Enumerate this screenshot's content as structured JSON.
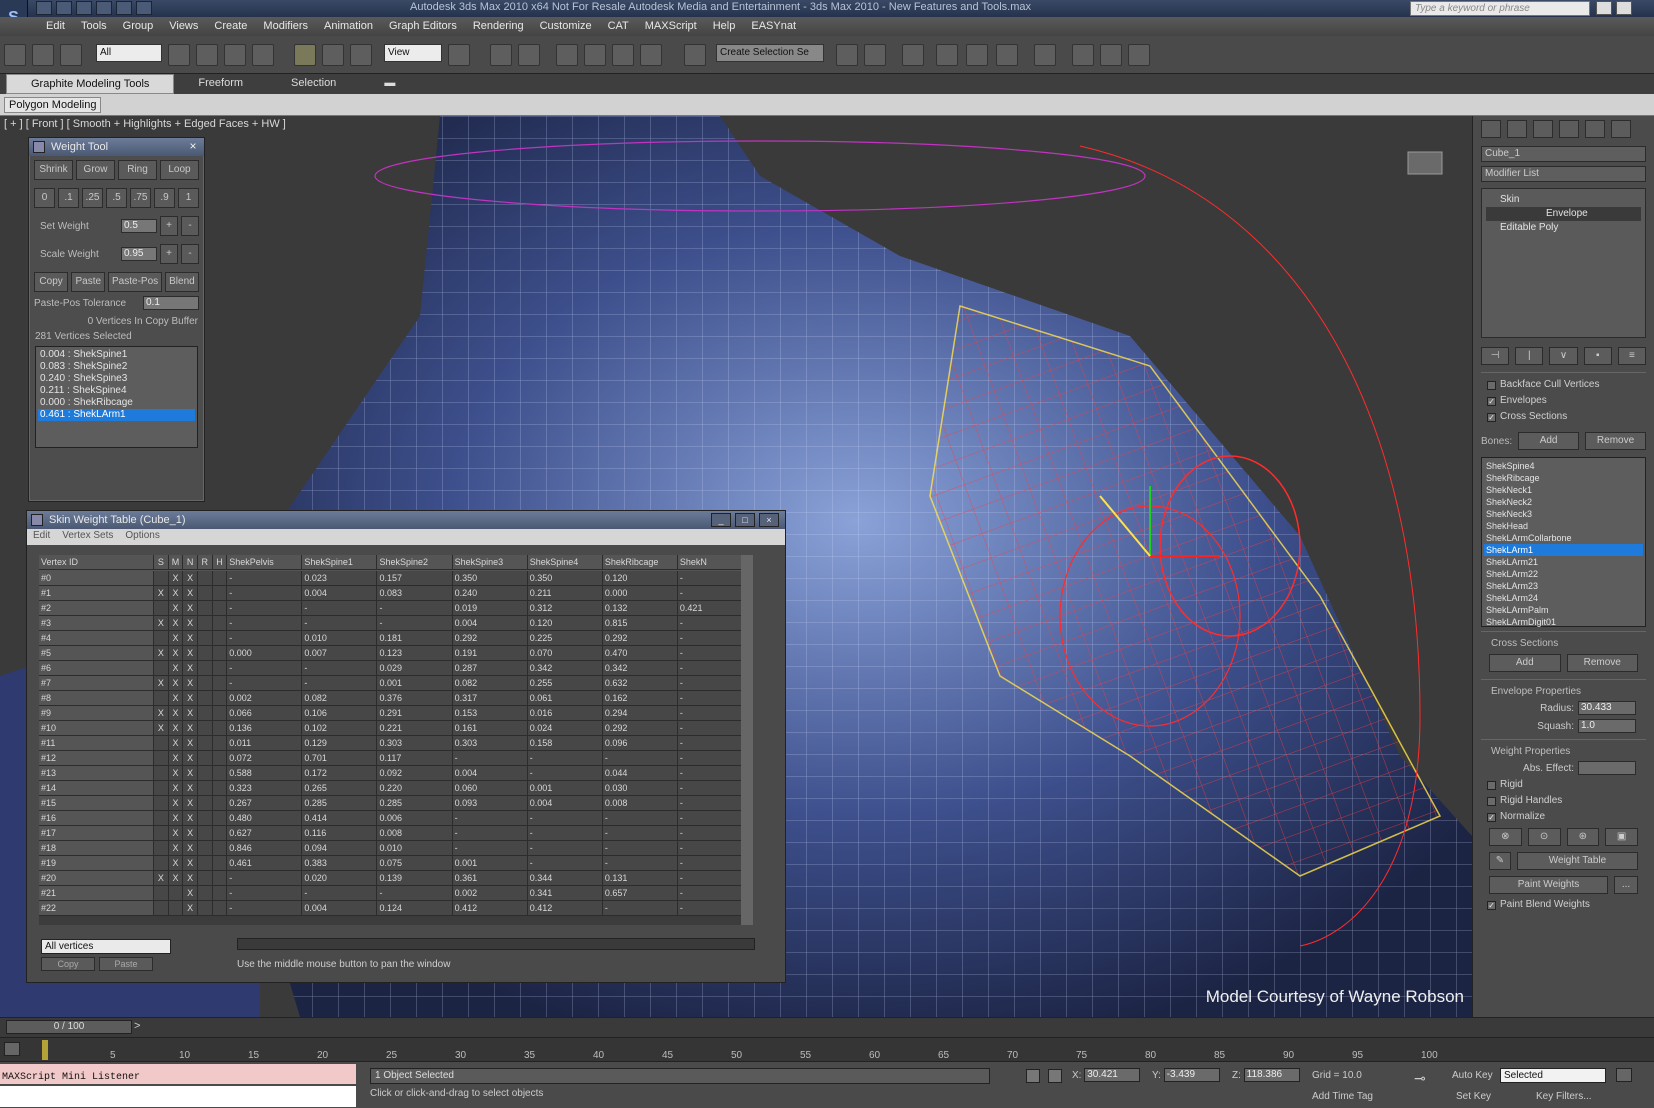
{
  "title_bar": {
    "title": "Autodesk 3ds Max 2010 x64     Not For Resale     Autodesk Media and Entertainment - 3ds Max 2010 - New Features and Tools.max",
    "search_placeholder": "Type a keyword or phrase"
  },
  "menu": [
    "Edit",
    "Tools",
    "Group",
    "Views",
    "Create",
    "Modifiers",
    "Animation",
    "Graph Editors",
    "Rendering",
    "Customize",
    "CAT",
    "MAXScript",
    "Help",
    "EASYnat"
  ],
  "toolbar": {
    "selection_filter": "All",
    "reference_coord": "View",
    "named_selection": "Create Selection Se"
  },
  "ribbon": {
    "tabs": [
      "Graphite Modeling Tools",
      "Freeform",
      "Selection"
    ],
    "active_panel": "Polygon Modeling"
  },
  "viewport": {
    "label": "[ + ] [ Front ] [ Smooth + Highlights + Edged Faces + HW ]",
    "credit": "Model Courtesy of Wayne Robson"
  },
  "weight_tool": {
    "title": "Weight Tool",
    "row1": [
      "Shrink",
      "Grow",
      "Ring",
      "Loop"
    ],
    "row2": [
      "0",
      ".1",
      ".25",
      ".5",
      ".75",
      ".9",
      "1"
    ],
    "set_weight_label": "Set Weight",
    "set_weight_value": "0.5",
    "scale_weight_label": "Scale Weight",
    "scale_weight_value": "0.95",
    "row3": [
      "Copy",
      "Paste",
      "Paste-Pos",
      "Blend"
    ],
    "tolerance_label": "Paste-Pos Tolerance",
    "tolerance_value": "0.1",
    "copy_buffer": "0 Vertices In Copy Buffer",
    "selected_count": "281 Vertices Selected",
    "list": [
      "0.004 : ShekSpine1",
      "0.083 : ShekSpine2",
      "0.240 : ShekSpine3",
      "0.211 : ShekSpine4",
      "0.000 : ShekRibcage",
      "0.461 : ShekLArm1"
    ]
  },
  "skin_table": {
    "title": "Skin Weight Table (Cube_1)",
    "menu": [
      "Edit",
      "Vertex Sets",
      "Options"
    ],
    "columns": [
      "Vertex ID",
      "S",
      "M",
      "N",
      "R",
      "H",
      "ShekPelvis",
      "ShekSpine1",
      "ShekSpine2",
      "ShekSpine3",
      "ShekSpine4",
      "ShekRibcage",
      "ShekN"
    ],
    "rows": [
      [
        "#0",
        "",
        "X",
        "X",
        "",
        "",
        "-",
        "0.023",
        "0.157",
        "0.350",
        "0.350",
        "0.120",
        "-"
      ],
      [
        "#1",
        "X",
        "X",
        "X",
        "",
        "",
        "-",
        "0.004",
        "0.083",
        "0.240",
        "0.211",
        "0.000",
        "-"
      ],
      [
        "#2",
        "",
        "X",
        "X",
        "",
        "",
        "-",
        "-",
        "-",
        "0.019",
        "0.312",
        "0.132",
        "0.421"
      ],
      [
        "#3",
        "X",
        "X",
        "X",
        "",
        "",
        "-",
        "-",
        "-",
        "0.004",
        "0.120",
        "0.815",
        "-"
      ],
      [
        "#4",
        "",
        "X",
        "X",
        "",
        "",
        "-",
        "0.010",
        "0.181",
        "0.292",
        "0.225",
        "0.292",
        "-"
      ],
      [
        "#5",
        "X",
        "X",
        "X",
        "",
        "",
        "0.000",
        "0.007",
        "0.123",
        "0.191",
        "0.070",
        "0.470",
        "-"
      ],
      [
        "#6",
        "",
        "X",
        "X",
        "",
        "",
        "-",
        "-",
        "0.029",
        "0.287",
        "0.342",
        "0.342",
        "-"
      ],
      [
        "#7",
        "X",
        "X",
        "X",
        "",
        "",
        "-",
        "-",
        "0.001",
        "0.082",
        "0.255",
        "0.632",
        "-"
      ],
      [
        "#8",
        "",
        "X",
        "X",
        "",
        "",
        "0.002",
        "0.082",
        "0.376",
        "0.317",
        "0.061",
        "0.162",
        "-"
      ],
      [
        "#9",
        "X",
        "X",
        "X",
        "",
        "",
        "0.066",
        "0.106",
        "0.291",
        "0.153",
        "0.016",
        "0.294",
        "-"
      ],
      [
        "#10",
        "X",
        "X",
        "X",
        "",
        "",
        "0.136",
        "0.102",
        "0.221",
        "0.161",
        "0.024",
        "0.292",
        "-"
      ],
      [
        "#11",
        "",
        "X",
        "X",
        "",
        "",
        "0.011",
        "0.129",
        "0.303",
        "0.303",
        "0.158",
        "0.096",
        "-"
      ],
      [
        "#12",
        "",
        "X",
        "X",
        "",
        "",
        "0.072",
        "0.701",
        "0.117",
        "-",
        "-",
        "-",
        "-"
      ],
      [
        "#13",
        "",
        "X",
        "X",
        "",
        "",
        "0.588",
        "0.172",
        "0.092",
        "0.004",
        "-",
        "0.044",
        "-"
      ],
      [
        "#14",
        "",
        "X",
        "X",
        "",
        "",
        "0.323",
        "0.265",
        "0.220",
        "0.060",
        "0.001",
        "0.030",
        "-"
      ],
      [
        "#15",
        "",
        "X",
        "X",
        "",
        "",
        "0.267",
        "0.285",
        "0.285",
        "0.093",
        "0.004",
        "0.008",
        "-"
      ],
      [
        "#16",
        "",
        "X",
        "X",
        "",
        "",
        "0.480",
        "0.414",
        "0.006",
        "-",
        "-",
        "-",
        "-"
      ],
      [
        "#17",
        "",
        "X",
        "X",
        "",
        "",
        "0.627",
        "0.116",
        "0.008",
        "-",
        "-",
        "-",
        "-"
      ],
      [
        "#18",
        "",
        "X",
        "X",
        "",
        "",
        "0.846",
        "0.094",
        "0.010",
        "-",
        "-",
        "-",
        "-"
      ],
      [
        "#19",
        "",
        "X",
        "X",
        "",
        "",
        "0.461",
        "0.383",
        "0.075",
        "0.001",
        "-",
        "-",
        "-"
      ],
      [
        "#20",
        "X",
        "X",
        "X",
        "",
        "",
        "-",
        "0.020",
        "0.139",
        "0.361",
        "0.344",
        "0.131",
        "-"
      ],
      [
        "#21",
        "",
        "",
        "X",
        "",
        "",
        "-",
        "-",
        "-",
        "0.002",
        "0.341",
        "0.657",
        "-"
      ],
      [
        "#22",
        "",
        "",
        "X",
        "",
        "",
        "-",
        "0.004",
        "0.124",
        "0.412",
        "0.412",
        "-",
        "-"
      ]
    ],
    "filter": "All vertices",
    "copy_label": "Copy",
    "paste_label": "Paste",
    "hint": "Use the middle mouse button to pan the window"
  },
  "command_panel": {
    "object_name": "Cube_1",
    "modifier_list": "Modifier List",
    "stack": [
      "Skin",
      "Envelope",
      "Editable Poly"
    ],
    "checks": [
      {
        "label": "Backface Cull Vertices",
        "checked": false
      },
      {
        "label": "Envelopes",
        "checked": true
      },
      {
        "label": "Cross Sections",
        "checked": true
      }
    ],
    "bones_label": "Bones:",
    "add": "Add",
    "remove": "Remove",
    "bones": [
      "ShekSpine4",
      "ShekRibcage",
      "ShekNeck1",
      "ShekNeck2",
      "ShekNeck3",
      "ShekHead",
      "ShekLArmCollarbone",
      "ShekLArm1",
      "ShekLArm21",
      "ShekLArm22",
      "ShekLArm23",
      "ShekLArm24",
      "ShekLArmPalm",
      "ShekLArmDigit01"
    ],
    "selected_bone": "ShekLArm1",
    "cross_sections_label": "Cross Sections",
    "envelope_props_label": "Envelope Properties",
    "radius_label": "Radius:",
    "radius_value": "30.433",
    "squash_label": "Squash:",
    "squash_value": "1.0",
    "weight_props_label": "Weight Properties",
    "abs_effect_label": "Abs. Effect:",
    "weight_checks": [
      {
        "label": "Rigid",
        "checked": false
      },
      {
        "label": "Rigid Handles",
        "checked": false
      },
      {
        "label": "Normalize",
        "checked": true
      }
    ],
    "weight_table_btn": "Weight Table",
    "paint_weights_btn": "Paint Weights",
    "paint_blend_label": "Paint Blend Weights"
  },
  "timeline": {
    "frame": "0 / 100",
    "ticks": [
      "5",
      "10",
      "15",
      "20",
      "25",
      "30",
      "35",
      "40",
      "45",
      "50",
      "55",
      "60",
      "65",
      "70",
      "75",
      "80",
      "85",
      "90",
      "95",
      "100"
    ]
  },
  "status": {
    "maxscript": "MAXScript Mini Listener",
    "selected": "1 Object Selected",
    "prompt": "Click or click-and-drag to select objects",
    "x": "30.421",
    "y": "-3.439",
    "z": "118.386",
    "grid": "Grid = 10.0",
    "add_time_tag": "Add Time Tag",
    "auto_key": "Auto Key",
    "key_mode": "Selected",
    "set_key": "Set Key",
    "key_filters": "Key Filters..."
  }
}
